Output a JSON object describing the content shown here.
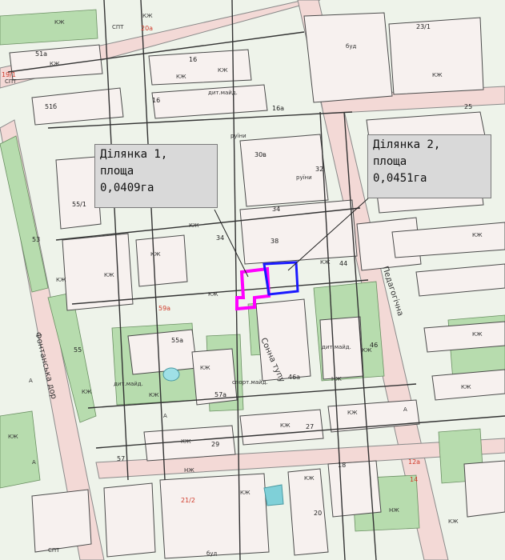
{
  "plots": [
    {
      "line1": "Ділянка 1,",
      "line2": "площа",
      "line3": "0,0409га",
      "color": "#ff00ff"
    },
    {
      "line1": "Ділянка 2,",
      "line2": "площа",
      "line3": "0,0451га",
      "color": "#1a1aff"
    }
  ],
  "streets": {
    "s1": "Фонтанська дор",
    "s2": "Сонна тупу",
    "s3": "Педагогічна"
  },
  "colors": {
    "background": "#eef3ea",
    "green": "#b7dcae",
    "block": "#f7f1ef",
    "road": "#f3d9d6",
    "water": "#9fe0e6"
  },
  "map_labels": {
    "kzh": "КЖ",
    "nzh": "НЖ",
    "bud": "буд",
    "spt": "СПТ",
    "dyt_maid": "дит.майд.",
    "sport_maid": "спорт.майд.",
    "ruyin": "руїни",
    "a": "А",
    "n51a": "51а",
    "n51b": "51б",
    "n53": "53",
    "n55": "55",
    "n55_1": "55/1",
    "n57": "57",
    "n57a": "57а",
    "n59a": "59а",
    "n55a": "55а",
    "n16": "16",
    "n16a": "16а",
    "n29": "29",
    "n27": "27",
    "n25": "25",
    "n32": "32",
    "n34": "34",
    "n38": "38",
    "n44": "44",
    "n46": "46",
    "n46a": "46а",
    "n30v": "30в",
    "n18": "18",
    "n20": "20",
    "n12a": "12а",
    "n14": "14",
    "n21_2": "21/2",
    "n20a": "20а",
    "n23_1": "23/1",
    "n19_1": "19/1"
  }
}
